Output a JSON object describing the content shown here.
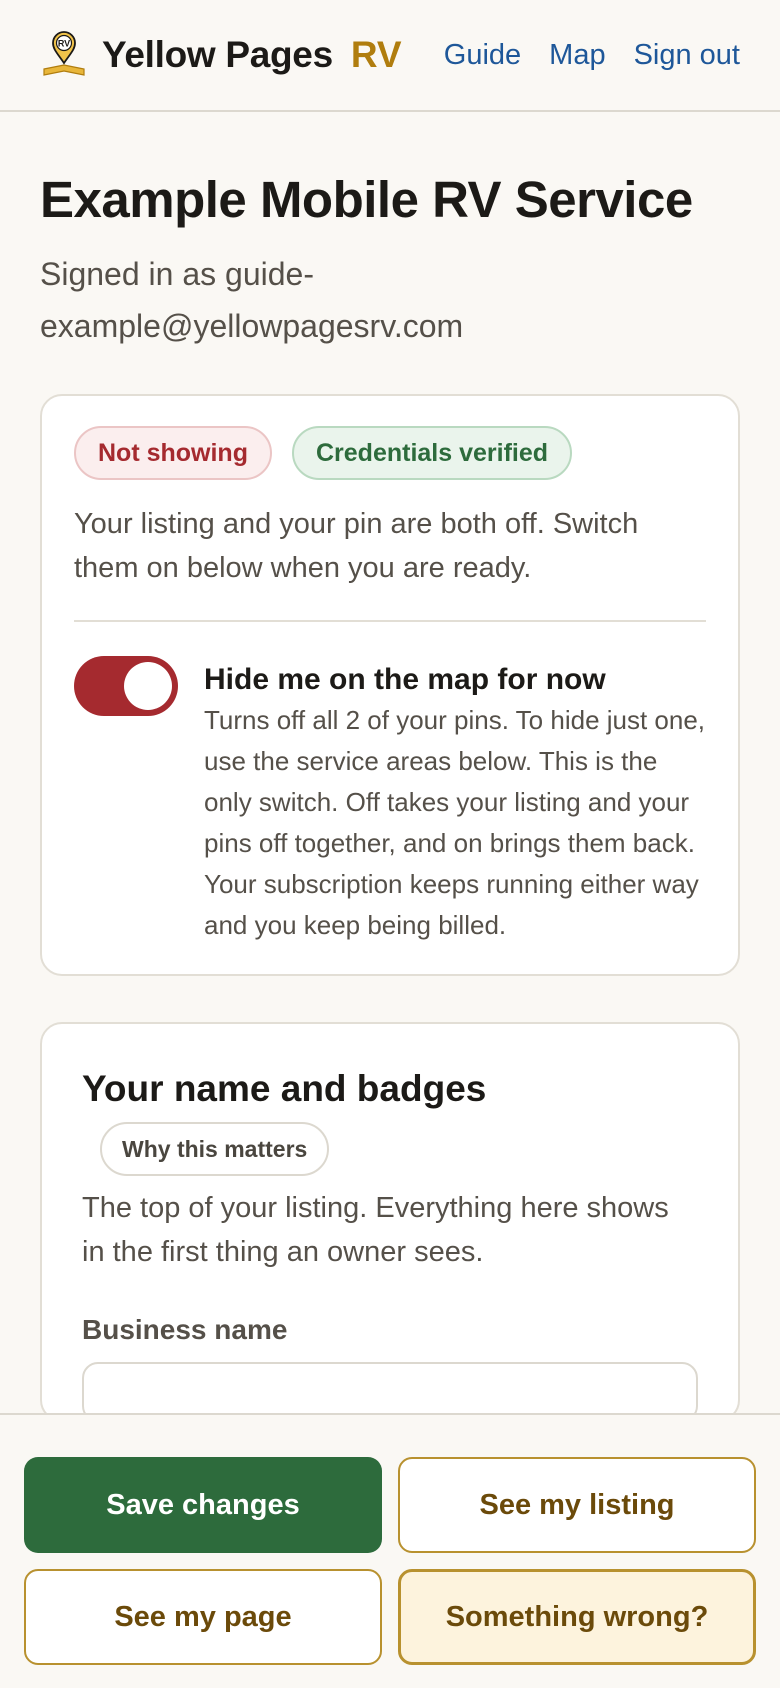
{
  "header": {
    "brand_name": "Yellow Pages",
    "brand_suffix": "RV",
    "logo_text": "RV",
    "nav": [
      "Guide",
      "Map",
      "Sign out"
    ]
  },
  "page": {
    "title": "Example Mobile RV Service",
    "signed_in": "Signed in as guide-example@yellowpagesrv.com"
  },
  "status": {
    "chips": [
      {
        "label": "Not showing",
        "color": "#a52a2f"
      },
      {
        "label": "Credentials verified",
        "color": "#2d6b3c"
      }
    ],
    "text": "Your listing and your pin are both off. Switch them on below when you are ready.",
    "toggle": {
      "on": true,
      "title": "Hide me on the map for now",
      "description": "Turns off all 2 of your pins. To hide just one, use the service areas below. This is the only switch. Off takes your listing and your pins off together, and on brings them back. Your subscription keeps running either way and you keep being billed."
    }
  },
  "name_section": {
    "title": "Your name and badges",
    "why_label": "Why this matters",
    "description": "The top of your listing. Everything here shows in the first thing an owner sees.",
    "business_name_label": "Business name",
    "business_name_value": ""
  },
  "actions": {
    "save": "Save changes",
    "see_listing": "See my listing",
    "see_page": "See my page",
    "something_wrong": "Something wrong?"
  },
  "colors": {
    "accent_green": "#2d6b3c",
    "accent_red": "#a52a2f",
    "brand_gold": "#b07d0e",
    "link_blue": "#1e5799"
  }
}
